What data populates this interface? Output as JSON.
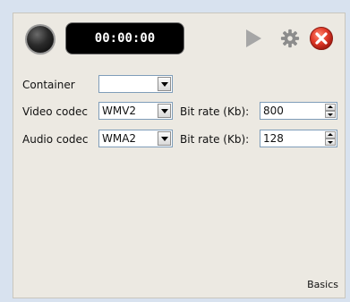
{
  "timer": {
    "display": "00:00:00"
  },
  "icons": {
    "record": "record-button",
    "play": "play-icon",
    "settings": "gear-icon",
    "close": "close-icon"
  },
  "form": {
    "container": {
      "label": "Container",
      "value": ""
    },
    "video": {
      "label": "Video codec",
      "value": "WMV2",
      "bitrate_label": "Bit rate (Kb):",
      "bitrate_value": "800"
    },
    "audio": {
      "label": "Audio codec",
      "value": "WMA2",
      "bitrate_label": "Bit rate (Kb):",
      "bitrate_value": "128"
    }
  },
  "tab": {
    "label": "Basics"
  },
  "colors": {
    "close_red": "#e23b2a",
    "background": "#ece9e2",
    "page_background": "#d8e2ef"
  }
}
